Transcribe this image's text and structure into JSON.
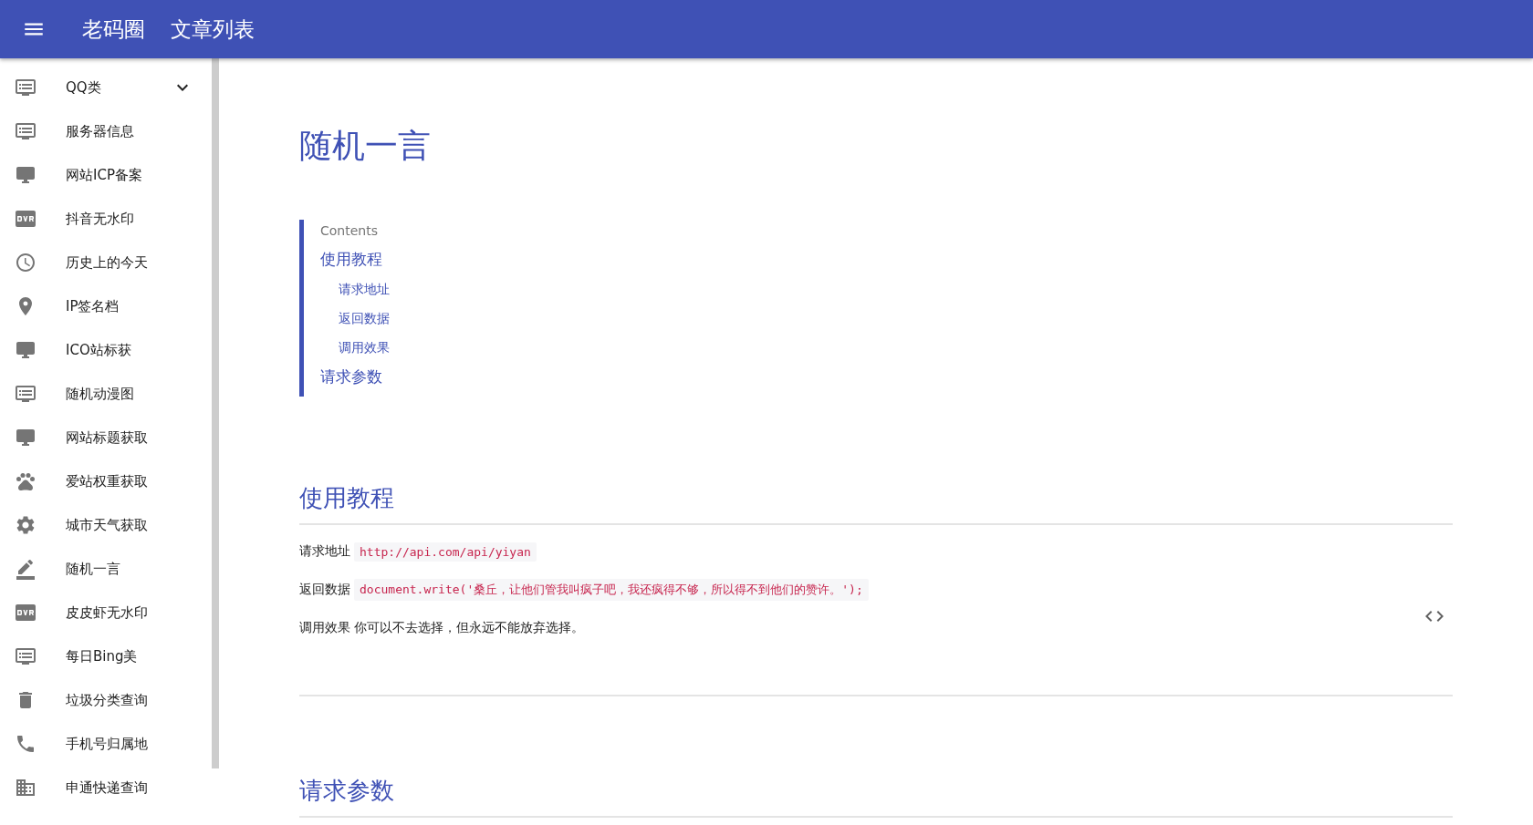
{
  "app_bar": {
    "site_title": "老码圈",
    "page_title": "文章列表"
  },
  "sidebar": {
    "items": [
      {
        "label": "QQ类",
        "kind": "monitor-list",
        "expanded": false
      },
      {
        "label": "服务器信息",
        "kind": "monitor-list"
      },
      {
        "label": "网站ICP备案",
        "kind": "monitor"
      },
      {
        "label": "抖音无水印",
        "kind": "video-badge"
      },
      {
        "label": "历史上的今天",
        "kind": "clock"
      },
      {
        "label": "IP签名档",
        "kind": "pin"
      },
      {
        "label": "ICO站标获",
        "kind": "monitor"
      },
      {
        "label": "随机动漫图",
        "kind": "monitor-list"
      },
      {
        "label": "网站标题获取",
        "kind": "monitor"
      },
      {
        "label": "爱站权重获取",
        "kind": "paw"
      },
      {
        "label": "城市天气获取",
        "kind": "gear"
      },
      {
        "label": "随机一言",
        "kind": "pencil"
      },
      {
        "label": "皮皮虾无水印",
        "kind": "video-badge"
      },
      {
        "label": "每日Bing美",
        "kind": "monitor-list"
      },
      {
        "label": "垃圾分类查询",
        "kind": "trash"
      },
      {
        "label": "手机号归属地",
        "kind": "phone"
      },
      {
        "label": "申通快递查询",
        "kind": "building"
      }
    ]
  },
  "article": {
    "title": "随机一言",
    "contents": {
      "label": "Contents",
      "items": [
        {
          "text": "使用教程",
          "children": [
            {
              "text": "请求地址"
            },
            {
              "text": "返回数据"
            },
            {
              "text": "调用效果"
            }
          ]
        },
        {
          "text": "请求参数"
        }
      ]
    },
    "sections": [
      {
        "heading": "使用教程",
        "rows": [
          {
            "label": "请求地址",
            "kind": "code",
            "value": "http://api.com/api/yiyan"
          },
          {
            "label": "返回数据",
            "kind": "code",
            "value": "document.write('桑丘，让他们管我叫疯子吧，我还疯得不够，所以得不到他们的赞许。');"
          },
          {
            "label": "调用效果",
            "kind": "text",
            "value": "你可以不去选择，但永远不能放弃选择。"
          }
        ]
      },
      {
        "heading": "请求参数"
      }
    ]
  }
}
